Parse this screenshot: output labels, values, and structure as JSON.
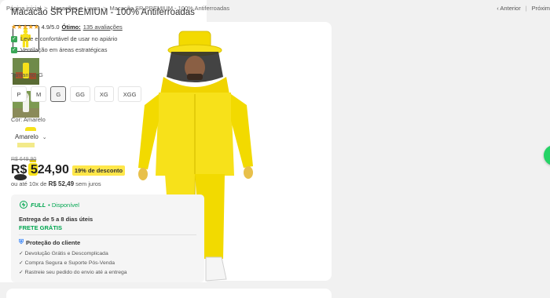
{
  "breadcrumb": {
    "home": "Página inicial",
    "category": "Macacões e Luvas",
    "current": "Macacão SR PREMIUM - 100% Antiferroadas",
    "separator": ">"
  },
  "pager": {
    "prev": "‹ Anterior",
    "divider": "|",
    "next": "Próxim"
  },
  "product": {
    "title": "Macacão SR PREMIUM - 100% Antiferroadas",
    "stars": "★★★★★",
    "rating_value": "4.9/5.0",
    "rating_label": "Ótimo:",
    "rating_count": "135 avaliações",
    "features": [
      "Leve e confortável de usar no apiário",
      "Ventilação em áreas estratégicas"
    ],
    "size_label": "Tamanho: G",
    "sizes": [
      "P",
      "M",
      "G",
      "GG",
      "XG",
      "XGG"
    ],
    "selected_size": "G",
    "color_label": "Cor: Amarelo",
    "color_value": "Amarelo",
    "old_price": "R$ 649,90",
    "price": "R$ 524,90",
    "discount": "19% de desconto",
    "installments_prefix": "ou até 10x de",
    "installments_value": "R$ 52,49",
    "installments_suffix": "sem juros"
  },
  "shipping": {
    "full_label": "FULL",
    "availability": "• Disponível",
    "delivery": "Entrega de 5 a 8 dias úteis",
    "free_shipping": "FRETE GRÁTIS",
    "protection_title": "Proteção do cliente",
    "bullets": [
      "✓ Devolução Grátis e Descomplicada",
      "✓ Compra Segura e Suporte Pós-Venda",
      "✓ Rastreie seu pedido do envio até a entrega"
    ]
  },
  "colors": {
    "accent_yellow": "#f5d800",
    "suit_yellow": "#f7e11a",
    "discount_bg": "#ffe74a",
    "full_green": "#00a650",
    "check_green": "#3aa757",
    "star": "#f5a623"
  },
  "icons": {
    "check": "check-icon",
    "lightning": "lightning-icon",
    "shield": "shield-icon",
    "chevron": "chevron-down-icon",
    "whatsapp": "whatsapp-icon"
  }
}
